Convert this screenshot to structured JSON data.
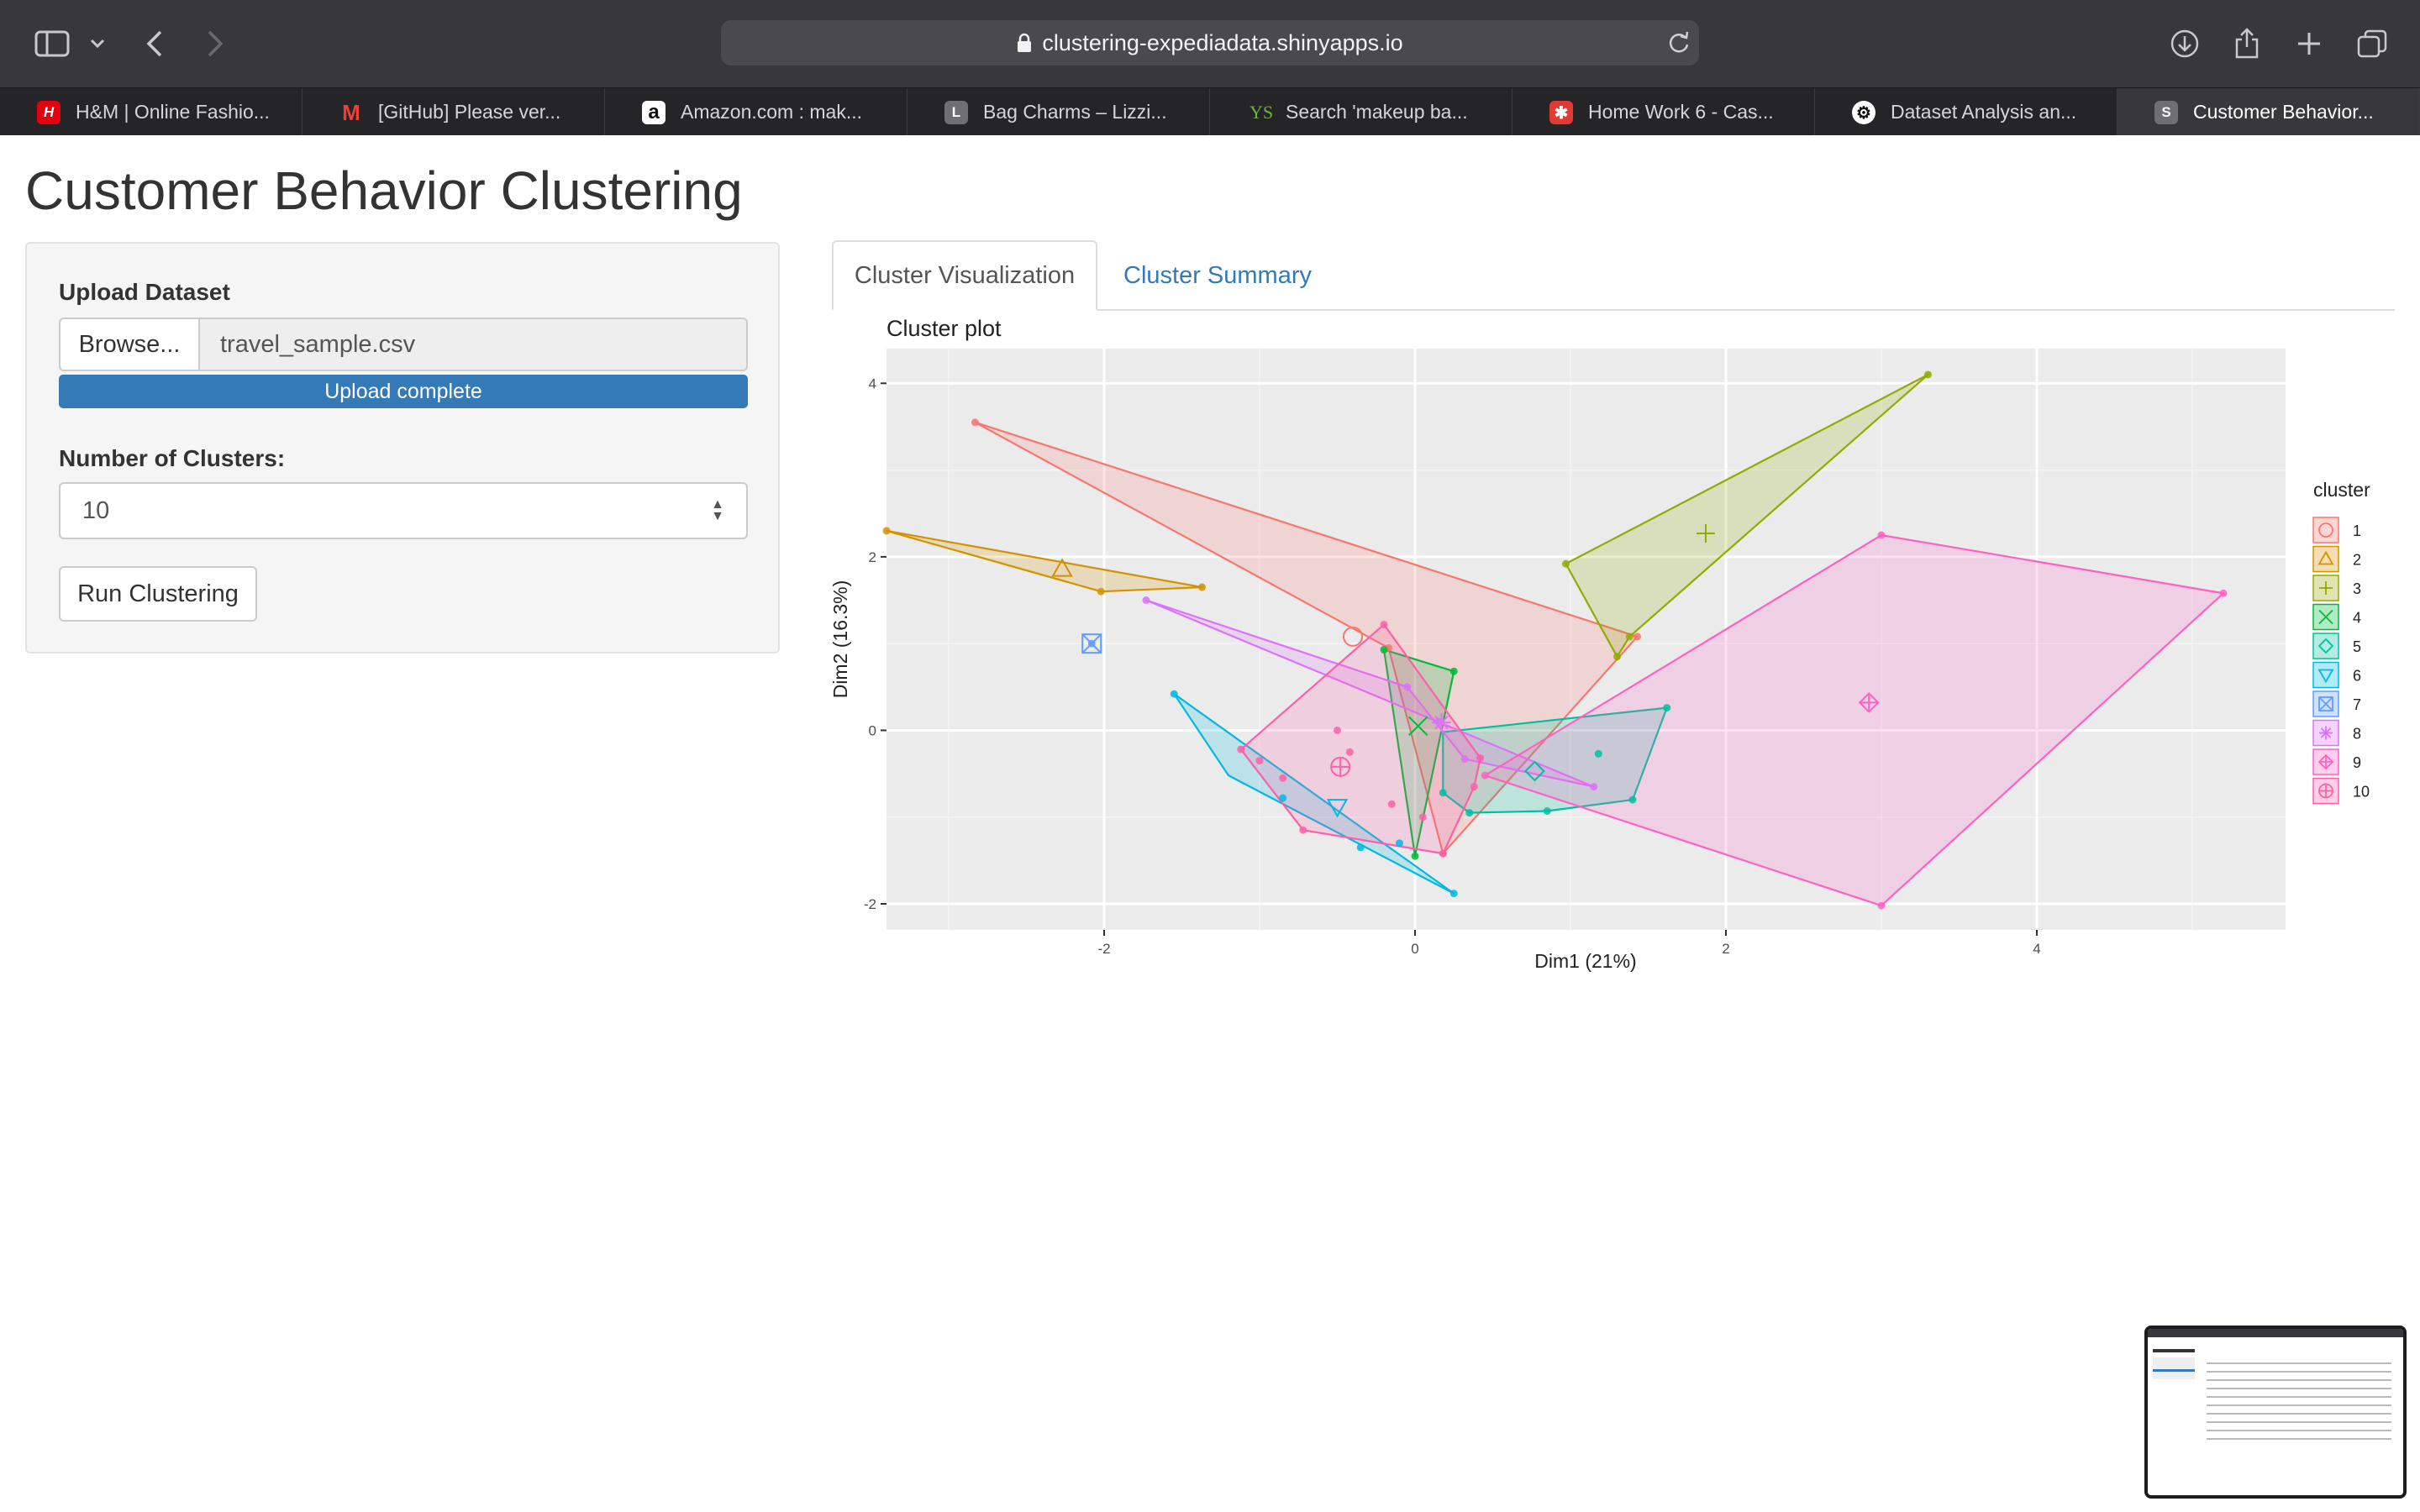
{
  "browser": {
    "url": "clustering-expediadata.shinyapps.io",
    "tabs": [
      {
        "label": "H&M | Online Fashio...",
        "icon": "hm-favicon-icon",
        "color": "#e50010",
        "glyph": "H"
      },
      {
        "label": "[GitHub] Please ver...",
        "icon": "gmail-favicon-icon",
        "color": "#ea4335",
        "glyph": "M"
      },
      {
        "label": "Amazon.com : mak...",
        "icon": "amazon-favicon-icon",
        "color": "#111111",
        "glyph": "a"
      },
      {
        "label": "Bag Charms – Lizzi...",
        "icon": "letter-l-favicon-icon",
        "color": "#6e6e73",
        "glyph": "L"
      },
      {
        "label": "Search 'makeup ba...",
        "icon": "yesstyle-favicon-icon",
        "color": "#252527",
        "glyph": "YS"
      },
      {
        "label": "Home Work 6 - Cas...",
        "icon": "canvas-favicon-icon",
        "color": "#e13a34",
        "glyph": "✱"
      },
      {
        "label": "Dataset Analysis an...",
        "icon": "chatgpt-favicon-icon",
        "color": "#ffffff",
        "glyph": "⚙"
      },
      {
        "label": "Customer Behavior...",
        "icon": "shiny-favicon-icon",
        "color": "#6e6e73",
        "glyph": "S"
      }
    ]
  },
  "app": {
    "title": "Customer Behavior Clustering",
    "upload_label": "Upload Dataset",
    "browse_label": "Browse...",
    "file_name": "travel_sample.csv",
    "upload_status": "Upload complete",
    "upload_progress": 1.0,
    "clusters_label": "Number of Clusters:",
    "clusters_value": "10",
    "run_label": "Run Clustering",
    "tabs": [
      "Cluster Visualization",
      "Cluster Summary"
    ],
    "active_tab": "Cluster Visualization"
  },
  "chart_data": {
    "type": "scatter",
    "title": "Cluster plot",
    "xlabel": "Dim1 (21%)",
    "ylabel": "Dim2 (16.3%)",
    "xlim": [
      -3.4,
      5.6
    ],
    "ylim": [
      -2.3,
      4.4
    ],
    "xticks": [
      -2,
      0,
      2,
      4
    ],
    "yticks": [
      -2,
      0,
      2,
      4
    ],
    "grid": true,
    "legend_title": "cluster",
    "legend_position": "right",
    "series": [
      {
        "name": "1",
        "color": "#F8766D",
        "shape": "circle",
        "hull": [
          [
            -2.83,
            3.55
          ],
          [
            1.43,
            1.08
          ],
          [
            0.18,
            -1.42
          ],
          [
            -0.17,
            0.95
          ]
        ],
        "points": [
          [
            -2.83,
            3.55
          ],
          [
            1.43,
            1.08
          ],
          [
            0.18,
            -1.42
          ],
          [
            -0.17,
            0.95
          ]
        ],
        "center": [
          -0.4,
          1.08
        ]
      },
      {
        "name": "2",
        "color": "#D39200",
        "shape": "triangle",
        "hull": [
          [
            -3.4,
            2.3
          ],
          [
            -1.37,
            1.65
          ],
          [
            -2.02,
            1.6
          ]
        ],
        "points": [
          [
            -3.4,
            2.3
          ],
          [
            -1.37,
            1.65
          ],
          [
            -2.02,
            1.6
          ]
        ],
        "center": [
          -2.27,
          1.86
        ]
      },
      {
        "name": "3",
        "color": "#93AA00",
        "shape": "plus",
        "hull": [
          [
            3.3,
            4.1
          ],
          [
            1.38,
            1.08
          ],
          [
            1.3,
            0.85
          ],
          [
            0.97,
            1.92
          ]
        ],
        "points": [
          [
            3.3,
            4.1
          ],
          [
            1.38,
            1.08
          ],
          [
            1.3,
            0.85
          ],
          [
            0.97,
            1.92
          ]
        ],
        "center": [
          1.87,
          2.27
        ]
      },
      {
        "name": "4",
        "color": "#00BA38",
        "shape": "cross",
        "hull": [
          [
            -0.2,
            0.93
          ],
          [
            0.25,
            0.68
          ],
          [
            0.0,
            -1.45
          ]
        ],
        "points": [
          [
            -0.2,
            0.93
          ],
          [
            0.25,
            0.68
          ],
          [
            0.0,
            -1.45
          ]
        ],
        "center": [
          0.02,
          0.05
        ]
      },
      {
        "name": "5",
        "color": "#00C19F",
        "shape": "diamond",
        "hull": [
          [
            0.18,
            -0.02
          ],
          [
            1.62,
            0.26
          ],
          [
            1.4,
            -0.8
          ],
          [
            0.85,
            -0.93
          ],
          [
            0.35,
            -0.95
          ],
          [
            0.18,
            -0.72
          ]
        ],
        "points": [
          [
            1.62,
            0.26
          ],
          [
            1.4,
            -0.8
          ],
          [
            0.85,
            -0.93
          ],
          [
            0.35,
            -0.95
          ],
          [
            0.18,
            -0.72
          ],
          [
            1.18,
            -0.27
          ]
        ],
        "center": [
          0.77,
          -0.47
        ]
      },
      {
        "name": "6",
        "color": "#00B9E3",
        "shape": "triangle-down",
        "hull": [
          [
            -1.55,
            0.42
          ],
          [
            0.25,
            -1.88
          ],
          [
            -1.2,
            -0.52
          ]
        ],
        "points": [
          [
            -1.55,
            0.42
          ],
          [
            0.25,
            -1.88
          ],
          [
            -0.85,
            -0.78
          ],
          [
            -0.35,
            -1.35
          ],
          [
            -0.1,
            -1.3
          ]
        ],
        "center": [
          -0.5,
          -0.88
        ]
      },
      {
        "name": "7",
        "color": "#619CFF",
        "shape": "square-cross",
        "hull": [],
        "points": [
          [
            -2.08,
            1.0
          ]
        ],
        "center": [
          -2.08,
          1.0
        ]
      },
      {
        "name": "8",
        "color": "#DB72FB",
        "shape": "asterisk",
        "hull": [
          [
            -1.73,
            1.5
          ],
          [
            1.15,
            -0.65
          ],
          [
            0.32,
            -0.33
          ],
          [
            -0.05,
            0.5
          ]
        ],
        "points": [
          [
            -1.73,
            1.5
          ],
          [
            1.15,
            -0.65
          ],
          [
            0.32,
            -0.33
          ],
          [
            -0.05,
            0.5
          ],
          [
            0.15,
            0.1
          ]
        ],
        "center": [
          0.17,
          0.09
        ]
      },
      {
        "name": "9",
        "color": "#FF61C3",
        "shape": "diamond-plus",
        "hull": [
          [
            3.0,
            2.25
          ],
          [
            5.2,
            1.58
          ],
          [
            3.0,
            -2.02
          ],
          [
            0.45,
            -0.52
          ]
        ],
        "points": [
          [
            3.0,
            2.25
          ],
          [
            5.2,
            1.58
          ],
          [
            3.0,
            -2.02
          ],
          [
            0.45,
            -0.52
          ]
        ],
        "center": [
          2.92,
          0.32
        ]
      },
      {
        "name": "10",
        "color": "#FF5FA8",
        "shape": "circle-plus",
        "hull": [
          [
            -0.2,
            1.22
          ],
          [
            0.42,
            -0.32
          ],
          [
            0.38,
            -0.65
          ],
          [
            0.18,
            -1.42
          ],
          [
            -0.72,
            -1.15
          ],
          [
            -1.12,
            -0.22
          ]
        ],
        "points": [
          [
            -0.2,
            1.22
          ],
          [
            0.42,
            -0.32
          ],
          [
            0.38,
            -0.65
          ],
          [
            0.18,
            -1.42
          ],
          [
            -0.72,
            -1.15
          ],
          [
            -1.12,
            -0.22
          ],
          [
            -0.5,
            0.0
          ],
          [
            -0.85,
            -0.55
          ],
          [
            -1.0,
            -0.35
          ],
          [
            -0.42,
            -0.25
          ],
          [
            -0.15,
            -0.85
          ],
          [
            0.05,
            -1.0
          ]
        ],
        "center": [
          -0.48,
          -0.42
        ]
      }
    ]
  }
}
